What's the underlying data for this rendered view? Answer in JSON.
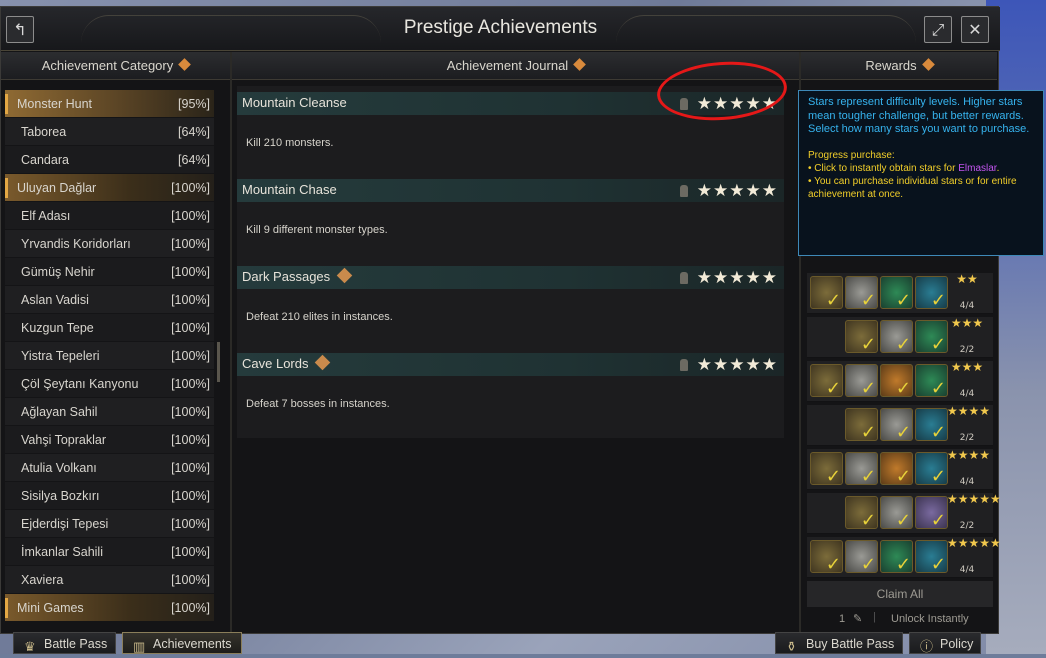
{
  "window": {
    "title": "Prestige Achievements"
  },
  "headers": {
    "category": "Achievement Category",
    "journal": "Achievement Journal",
    "rewards": "Rewards"
  },
  "categories": [
    {
      "name": "Monster Hunt",
      "pct": "[95%]",
      "main": true,
      "selected": true
    },
    {
      "name": "Taborea",
      "pct": "[64%]"
    },
    {
      "name": "Candara",
      "pct": "[64%]"
    },
    {
      "name": "Uluyan Dağlar",
      "pct": "[100%]",
      "main": true
    },
    {
      "name": "Elf Adası",
      "pct": "[100%]"
    },
    {
      "name": "Yrvandis Koridorları",
      "pct": "[100%]"
    },
    {
      "name": "Gümüş Nehir",
      "pct": "[100%]"
    },
    {
      "name": "Aslan Vadisi",
      "pct": "[100%]"
    },
    {
      "name": "Kuzgun Tepe",
      "pct": "[100%]"
    },
    {
      "name": "Yistra Tepeleri",
      "pct": "[100%]"
    },
    {
      "name": "Çöl Şeytanı Kanyonu",
      "pct": "[100%]"
    },
    {
      "name": "Ağlayan Sahil",
      "pct": "[100%]"
    },
    {
      "name": "Vahşi Topraklar",
      "pct": "[100%]"
    },
    {
      "name": "Atulia Volkanı",
      "pct": "[100%]"
    },
    {
      "name": "Sisilya Bozkırı",
      "pct": "[100%]"
    },
    {
      "name": "Ejderdişi Tepesi",
      "pct": "[100%]"
    },
    {
      "name": "İmkanlar Sahili",
      "pct": "[100%]"
    },
    {
      "name": "Xaviera",
      "pct": "[100%]"
    },
    {
      "name": "Mini Games",
      "pct": "[100%]",
      "main": true
    }
  ],
  "achievements": [
    {
      "title": "Mountain Cleanse",
      "desc": "Kill 210 monsters.",
      "stars": "★★★★★",
      "gem": false
    },
    {
      "title": "Mountain Chase",
      "desc": "Kill 9 different monster types.",
      "stars": "★★★★★",
      "gem": false
    },
    {
      "title": "Dark Passages",
      "desc": "Defeat 210 elites in instances.",
      "stars": "★★★★★",
      "gem": true
    },
    {
      "title": "Cave Lords",
      "desc": "Defeat 7 bosses in instances.",
      "stars": "★★★★★",
      "gem": true
    }
  ],
  "rewards": {
    "counts": [
      "4/4",
      "2/2",
      "4/4",
      "2/2",
      "4/4",
      "2/2",
      "4/4"
    ],
    "stars": [
      "★★",
      "★★★",
      "★★★",
      "★★★★",
      "★★★★",
      "★★★★★",
      "★★★★★"
    ],
    "claim_all": "Claim All",
    "unlock_count": "1",
    "unlock_label": "Unlock Instantly"
  },
  "tooltip": {
    "line1": "Stars represent difficulty levels. Higher stars mean tougher challenge, but better rewards.",
    "line2": "Select how many stars you want to purchase.",
    "heading": "Progress purchase:",
    "bullet1a": "• Click to instantly obtain stars for",
    "bullet1b": "Elmaslar",
    "bullet2": "• You can purchase individual stars or for entire achievement at once."
  },
  "tabs": {
    "battle_pass": "Battle Pass",
    "achievements": "Achievements",
    "buy_battle_pass": "Buy Battle Pass",
    "policy": "Policy"
  },
  "colors": {
    "accent": "#e3a744",
    "tooltip_text": "#36b3ee",
    "tooltip_highlight": "#f2cf2a",
    "annotation": "#e51818"
  }
}
